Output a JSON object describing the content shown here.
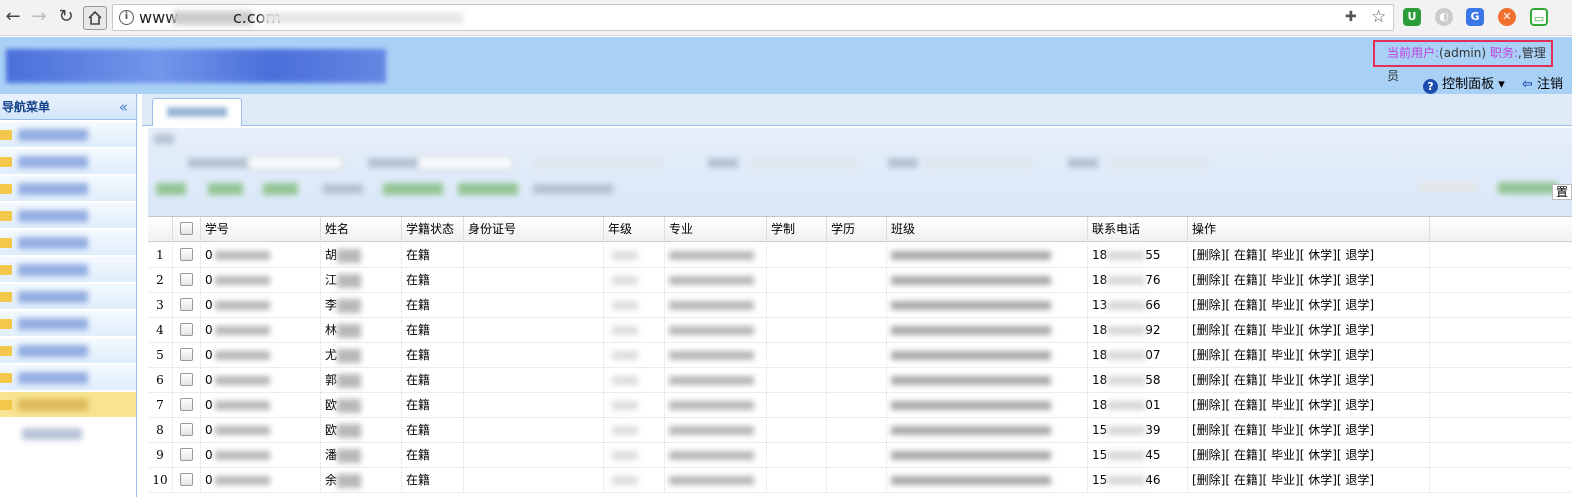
{
  "browser": {
    "url_prefix": "www",
    "url_suffix": "c.com",
    "back_icon": "back-arrow-icon",
    "forward_icon": "forward-arrow-icon",
    "reload_icon": "reload-icon",
    "home_icon": "home-icon"
  },
  "header": {
    "user_label": "当前用户:",
    "user_value": "(admin)",
    "role_label": " 职务:",
    "role_value": ",管理员",
    "control_panel": "控制面板",
    "logout": "注销"
  },
  "sidebar": {
    "title": "导航菜单",
    "collapse_icon": "double-chevron-left-icon"
  },
  "toolbar": {
    "right_text": "置"
  },
  "table": {
    "columns": [
      "学号",
      "姓名",
      "学籍状态",
      "身份证号",
      "年级",
      "专业",
      "学制",
      "学历",
      "班级",
      "联系电话",
      "操作"
    ],
    "rows": [
      {
        "num": "1",
        "id": "0",
        "name": "胡",
        "status": "在籍",
        "phone_pre": "18",
        "phone_suf": "55",
        "actions": "[删除][ 在籍][ 毕业][ 休学][ 退学]"
      },
      {
        "num": "2",
        "id": "0",
        "name": "江",
        "status": "在籍",
        "phone_pre": "18",
        "phone_suf": "76",
        "actions": "[删除][ 在籍][ 毕业][ 休学][ 退学]"
      },
      {
        "num": "3",
        "id": "0",
        "name": "李",
        "status": "在籍",
        "phone_pre": "13",
        "phone_suf": "66",
        "actions": "[删除][ 在籍][ 毕业][ 休学][ 退学]"
      },
      {
        "num": "4",
        "id": "0",
        "name": "林",
        "status": "在籍",
        "phone_pre": "18",
        "phone_suf": "92",
        "actions": "[删除][ 在籍][ 毕业][ 休学][ 退学]"
      },
      {
        "num": "5",
        "id": "0",
        "name": "尤",
        "status": "在籍",
        "phone_pre": "18",
        "phone_suf": "07",
        "actions": "[删除][ 在籍][ 毕业][ 休学][ 退学]"
      },
      {
        "num": "6",
        "id": "0",
        "name": "郭",
        "status": "在籍",
        "phone_pre": "18",
        "phone_suf": "58",
        "actions": "[删除][ 在籍][ 毕业][ 休学][ 退学]"
      },
      {
        "num": "7",
        "id": "0",
        "name": "欧",
        "status": "在籍",
        "phone_pre": "18",
        "phone_suf": "01",
        "actions": "[删除][ 在籍][ 毕业][ 休学][ 退学]"
      },
      {
        "num": "8",
        "id": "0",
        "name": "欧",
        "status": "在籍",
        "phone_pre": "15",
        "phone_suf": "39",
        "actions": "[删除][ 在籍][ 毕业][ 休学][ 退学]"
      },
      {
        "num": "9",
        "id": "0",
        "name": "潘",
        "status": "在籍",
        "phone_pre": "15",
        "phone_suf": "45",
        "actions": "[删除][ 在籍][ 毕业][ 休学][ 退学]"
      },
      {
        "num": "10",
        "id": "0",
        "name": "余",
        "status": "在籍",
        "phone_pre": "15",
        "phone_suf": "46",
        "actions": "[删除][ 在籍][ 毕业][ 休学][ 退学]"
      }
    ]
  },
  "colors": {
    "banner": "#a9d0f5",
    "user_label": "#c040e0",
    "highlight_box": "#e0305a",
    "active_menu": "#f7e390"
  }
}
